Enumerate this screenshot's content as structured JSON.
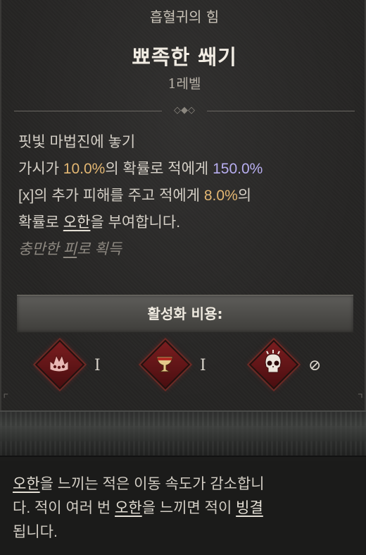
{
  "header": {
    "category": "흡혈귀의 힘",
    "skill_name": "뾰족한 쐐기",
    "level": "1레벨"
  },
  "description": {
    "line1": "핏빛 마법진에 놓기",
    "line2_a": "가시가 ",
    "line2_chance": "10.0%",
    "line2_b": "의 확률로 적에게 ",
    "line2_damage": "150.0%",
    "line3_a": "[x]의 추가 피해를 주고 적에게 ",
    "line3_chance": "8.0%",
    "line3_b": "의",
    "line4_a": "확률로 ",
    "line4_keyword": "오한",
    "line4_b": "을 부여합니다.",
    "line5_a": "충만한 ",
    "line5_keyword": "피",
    "line5_b": "로 획득"
  },
  "cost": {
    "label": "활성화 비용:",
    "items": [
      {
        "icon": "crown-icon",
        "quantity": "I"
      },
      {
        "icon": "chalice-icon",
        "quantity": "I"
      },
      {
        "icon": "skull-icon",
        "quantity": "⊘"
      }
    ]
  },
  "footer": {
    "l1_keyword": "오한",
    "l1_text": "을 느끼는 적은 이동 속도가 감소합니",
    "l2_a": "다. 적이 여러 번 ",
    "l2_keyword": "오한",
    "l2_b": "을 느끼면 적이 ",
    "l2_keyword2": "빙결",
    "l3": "됩니다."
  },
  "colors": {
    "highlight_yellow": "#e3b773",
    "highlight_violet": "#b8aef0",
    "icon_red": "#7a1d1f"
  }
}
